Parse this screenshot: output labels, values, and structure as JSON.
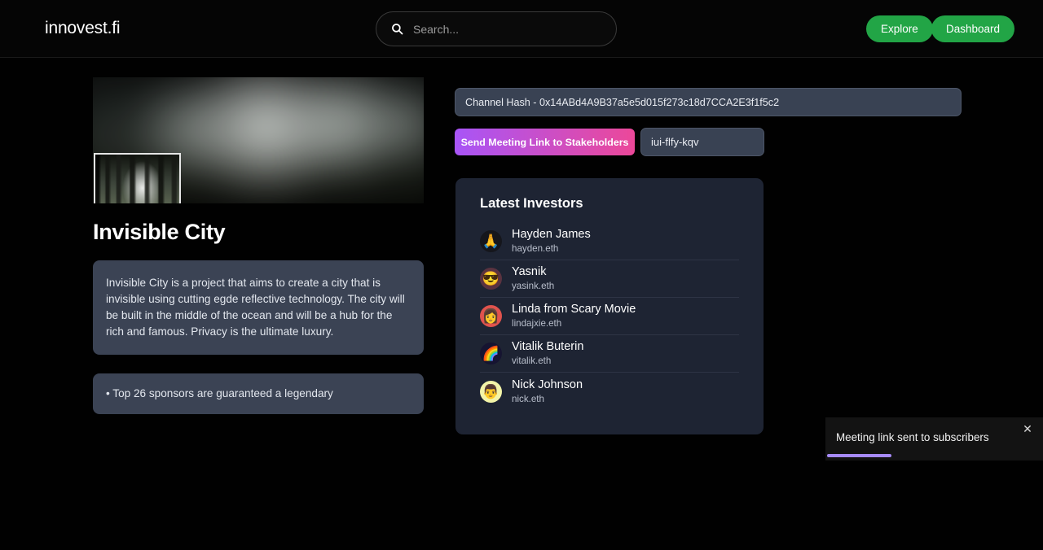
{
  "header": {
    "logo": "innovest.fi",
    "search": {
      "placeholder": "Search...",
      "value": "",
      "icon": "search-icon"
    },
    "explore_label": "Explore",
    "dashboard_label": "Dashboard",
    "button_color": "#22a546"
  },
  "project": {
    "title": "Invisible City",
    "description": "Invisible City is a project that aims to create a city that is invisible using cutting egde reflective technology. The city will be built in the middle of the ocean and will be a hub for the rich and famous. Privacy is the ultimate luxury.",
    "sponsors_note": "• Top 26 sponsors are guaranteed a legendary"
  },
  "channel": {
    "hash_label": "Channel Hash - 0x14ABd4A9B37a5e5d015f273c18d7CCA2E3f1f5c2",
    "send_button_label": "Send Meeting Link to Stakeholders",
    "meeting_code": "iui-flfy-kqv",
    "gradient_from": "#a855f7",
    "gradient_to": "#ec4899"
  },
  "investors": {
    "title": "Latest Investors",
    "items": [
      {
        "name": "Hayden James",
        "handle": "hayden.eth",
        "avatar_glyph": "🙏",
        "avatar_class": "av-hayden",
        "avatar_name": "praying-hands-avatar"
      },
      {
        "name": "Yasnik",
        "handle": "yasink.eth",
        "avatar_glyph": "😎",
        "avatar_class": "av-yasnik",
        "avatar_name": "sunglasses-avatar"
      },
      {
        "name": "Linda from Scary Movie",
        "handle": "lindajxie.eth",
        "avatar_glyph": "👩",
        "avatar_class": "av-linda",
        "avatar_name": "woman-face-avatar"
      },
      {
        "name": "Vitalik Buterin",
        "handle": "vitalik.eth",
        "avatar_glyph": "🌈",
        "avatar_class": "av-vitalik",
        "avatar_name": "nyan-cat-avatar"
      },
      {
        "name": "Nick Johnson",
        "handle": "nick.eth",
        "avatar_glyph": "👨",
        "avatar_class": "av-nick",
        "avatar_name": "man-face-avatar"
      }
    ]
  },
  "toast": {
    "message": "Meeting link sent to subscribers",
    "close_glyph": "✕",
    "progress_percent": 30,
    "progress_color": "#a78bfa"
  }
}
